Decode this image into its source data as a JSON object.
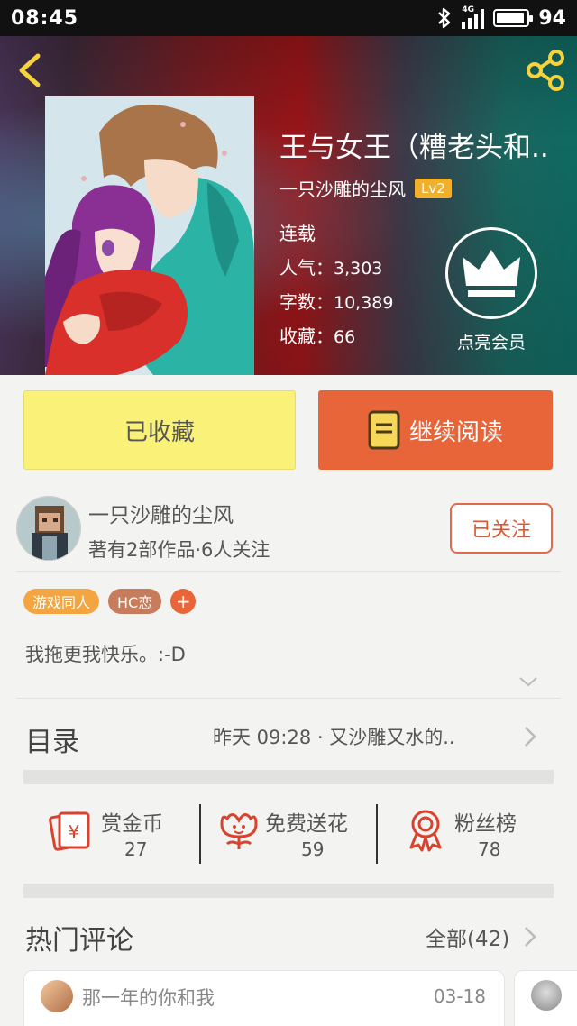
{
  "status_bar": {
    "time": "08:45",
    "network": "4G",
    "battery": "94"
  },
  "book": {
    "title": "王与女王（糟老头和..",
    "author": "一只沙雕的尘风",
    "author_level": "Lv2",
    "status": "连载",
    "popularity_label": "人气：",
    "popularity": "3,303",
    "words_label": "字数：",
    "words": "10,389",
    "favorites_label": "收藏：",
    "favorites": "66",
    "vip_label": "点亮会员"
  },
  "actions": {
    "collected": "已收藏",
    "continue_reading": "继续阅读"
  },
  "author_info": {
    "name": "一只沙雕的尘风",
    "stats": "著有2部作品·6人关注",
    "follow": "已关注"
  },
  "tags": [
    "游戏同人",
    "HC恋"
  ],
  "tag_add": "+",
  "description": "我拖更我快乐。:-D",
  "toc": {
    "label": "目录",
    "latest": "昨天 09:28 · 又沙雕又水的.."
  },
  "stats": [
    {
      "label": "赏金币",
      "count": "27"
    },
    {
      "label": "免费送花",
      "count": "59"
    },
    {
      "label": "粉丝榜",
      "count": "78"
    }
  ],
  "hot_comments": {
    "label": "热门评论",
    "all": "全部(42)",
    "items": [
      {
        "user": "那一年的你和我",
        "date": "03-18"
      }
    ]
  },
  "colors": {
    "accent": "#e8653a",
    "collected_bg": "#f9f178",
    "badge": "#f0b02b",
    "tag1": "#f2a540",
    "tag2": "#c77d5c"
  }
}
